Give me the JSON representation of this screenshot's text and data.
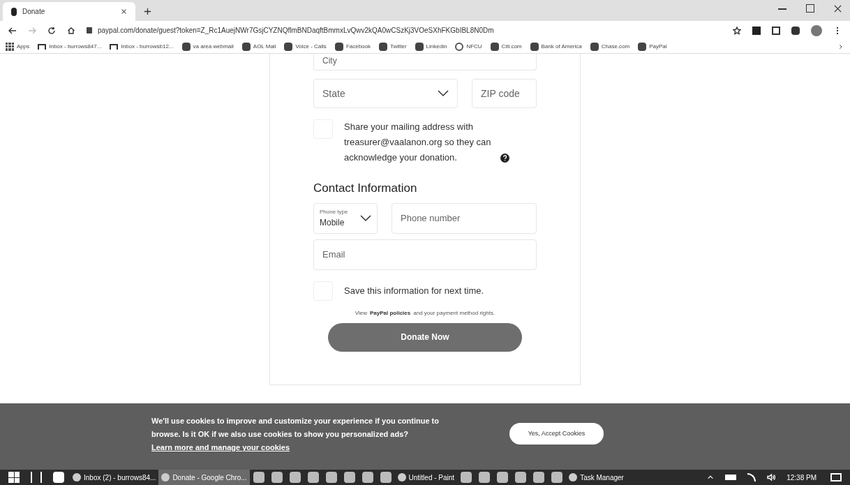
{
  "browser": {
    "tabs": [
      {
        "title": "Donate",
        "selected": true
      }
    ],
    "address": "paypal.com/donate/guest?token=Z_Rc1AuejNWr7GsjCYZNQflmBNDaqftBmmxLvQwv2kQA0wCSzKj3VOeSXhFKGbIBL8N0Dm",
    "bookmarks": [
      {
        "label": "Apps",
        "kind": "apps"
      },
      {
        "label": "Inbox - burrows847...",
        "kind": "mail"
      },
      {
        "label": "Inbox - burrowsb12...",
        "kind": "mail"
      },
      {
        "label": "va area webmail",
        "kind": "web"
      },
      {
        "label": "AOL Mail",
        "kind": "web"
      },
      {
        "label": "Voice - Calls",
        "kind": "web"
      },
      {
        "label": "Facebook",
        "kind": "web"
      },
      {
        "label": "Twitter",
        "kind": "web"
      },
      {
        "label": "Linkedin",
        "kind": "web"
      },
      {
        "label": "NFCU",
        "kind": "globe"
      },
      {
        "label": "Citi.com",
        "kind": "web"
      },
      {
        "label": "Bank of America",
        "kind": "web"
      },
      {
        "label": "Chase.com",
        "kind": "web"
      },
      {
        "label": "PayPal",
        "kind": "web"
      }
    ]
  },
  "form": {
    "city": {
      "placeholder": "City"
    },
    "state": {
      "placeholder": "State"
    },
    "zip": {
      "placeholder": "ZIP code"
    },
    "share": {
      "checked": false,
      "label": "Share your mailing address with treasurer@vaalanon.org so they can acknowledge your donation."
    },
    "contact_heading": "Contact Information",
    "phone_type": {
      "label": "Phone type",
      "value": "Mobile"
    },
    "phone": {
      "placeholder": "Phone number"
    },
    "email": {
      "placeholder": "Email"
    },
    "save": {
      "checked": false,
      "label": "Save this information for next time."
    },
    "policy": {
      "before": "View",
      "link": "PayPal policies",
      "after": "and your payment method rights."
    },
    "donate_button": "Donate Now"
  },
  "cookie_banner": {
    "text": "We'll use cookies to improve and customize your experience if you continue to browse. Is it OK if we also use cookies to show you personalized ads?",
    "link": "Learn more and manage your cookies",
    "button": "Yes, Accept Cookies"
  },
  "taskbar": {
    "items": [
      {
        "kind": "start"
      },
      {
        "kind": "taskview"
      },
      {
        "kind": "store"
      },
      {
        "kind": "app",
        "label": "Inbox (2) - burrows84...",
        "selected": false
      },
      {
        "kind": "app",
        "label": "Donate - Google Chro...",
        "selected": true
      },
      {
        "kind": "icon"
      },
      {
        "kind": "icon"
      },
      {
        "kind": "icon"
      },
      {
        "kind": "icon"
      },
      {
        "kind": "icon"
      },
      {
        "kind": "icon"
      },
      {
        "kind": "icon"
      },
      {
        "kind": "icon"
      },
      {
        "kind": "app",
        "label": "Untitled - Paint",
        "selected": false
      },
      {
        "kind": "icon"
      },
      {
        "kind": "icon"
      },
      {
        "kind": "icon"
      },
      {
        "kind": "icon"
      },
      {
        "kind": "icon"
      },
      {
        "kind": "icon"
      },
      {
        "kind": "app",
        "label": "Task Manager",
        "selected": false
      }
    ],
    "time": "12:38 PM"
  }
}
